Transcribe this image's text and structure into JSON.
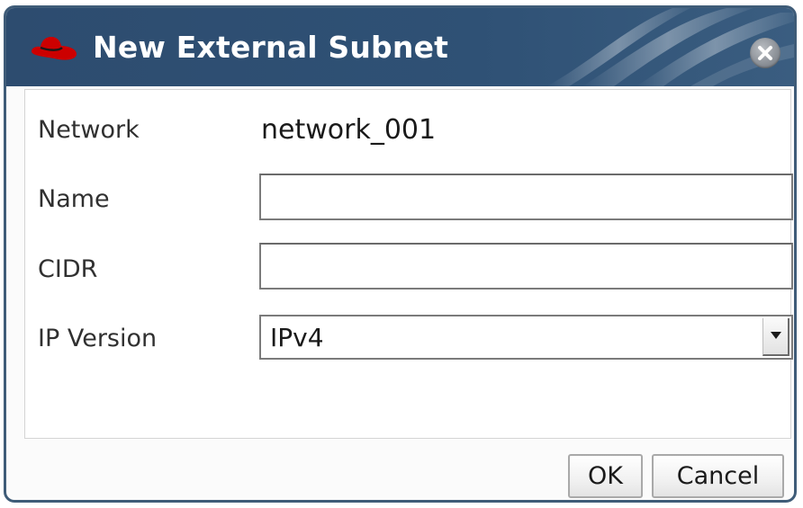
{
  "dialog": {
    "title": "New External Subnet",
    "header_icon": "redhat-hat-icon",
    "close_icon": "close-icon",
    "colors": {
      "header": "#2f5175",
      "border": "#3f5c78",
      "hat": "#cc0000"
    }
  },
  "form": {
    "network": {
      "label": "Network",
      "value": "network_001"
    },
    "name": {
      "label": "Name",
      "value": ""
    },
    "cidr": {
      "label": "CIDR",
      "value": ""
    },
    "ip_version": {
      "label": "IP Version",
      "selected": "IPv4"
    }
  },
  "buttons": {
    "ok": "OK",
    "cancel": "Cancel"
  }
}
